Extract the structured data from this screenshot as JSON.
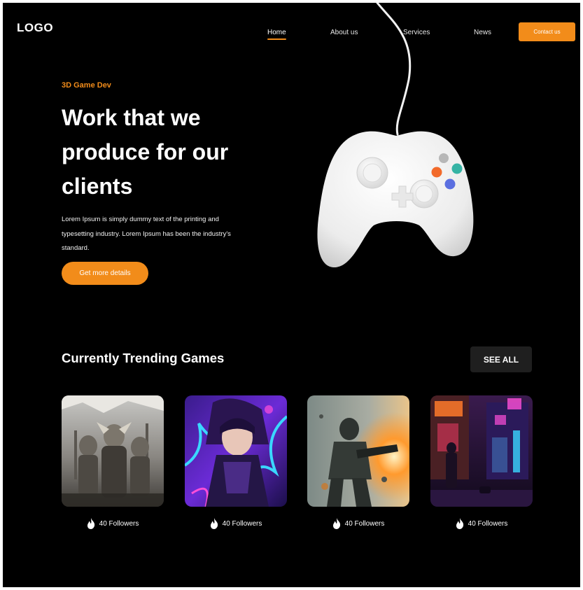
{
  "header": {
    "logo": "LOGO",
    "nav": [
      {
        "label": "Home",
        "active": true
      },
      {
        "label": "About us",
        "active": false
      },
      {
        "label": "Services",
        "active": false
      },
      {
        "label": "News",
        "active": false
      }
    ],
    "contact_label": "Contact us"
  },
  "hero": {
    "eyebrow": "3D Game Dev",
    "title_lines": [
      "Work that we",
      "produce for our",
      "clients"
    ],
    "description_lines": [
      "Lorem Ipsum is simply dummy text of the printing and",
      "typesetting industry. Lorem Ipsum has been the industry's",
      "standard."
    ],
    "cta_label": "Get more details"
  },
  "trending": {
    "title": "Currently Trending Games",
    "see_all_label": "SEE ALL",
    "games": [
      {
        "followers": "40 Followers",
        "icon": "flame-icon"
      },
      {
        "followers": "40 Followers",
        "icon": "flame-icon"
      },
      {
        "followers": "40 Followers",
        "icon": "flame-icon"
      },
      {
        "followers": "40 Followers",
        "icon": "flame-icon"
      }
    ]
  },
  "colors": {
    "accent": "#f28c1a",
    "background": "#000000",
    "button_dark": "#1f1f1f"
  }
}
